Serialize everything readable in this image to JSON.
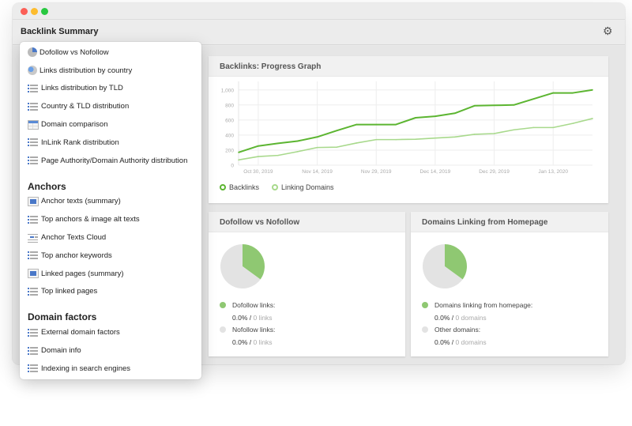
{
  "window": {
    "title": "Backlink Summary",
    "settings_icon": "gear-icon"
  },
  "menu": {
    "groups": [
      {
        "heading": "",
        "items": [
          {
            "label": "Dofollow vs Nofollow",
            "icon": "pie-chart-icon"
          },
          {
            "label": "Links distribution by country",
            "icon": "globe-icon"
          },
          {
            "label": "Links distribution by TLD",
            "icon": "list-icon"
          },
          {
            "label": "Country & TLD distribution",
            "icon": "list-icon"
          },
          {
            "label": "Domain comparison",
            "icon": "table-icon"
          },
          {
            "label": "InLink Rank distribution",
            "icon": "list-icon"
          },
          {
            "label": "Page Authority/Domain Authority distribution",
            "icon": "list-icon"
          }
        ]
      },
      {
        "heading": "Anchors",
        "items": [
          {
            "label": "Anchor texts (summary)",
            "icon": "summary-box-icon"
          },
          {
            "label": "Top anchors & image alt texts",
            "icon": "list-icon"
          },
          {
            "label": "Anchor Texts Cloud",
            "icon": "tag-cloud-icon"
          },
          {
            "label": "Top anchor keywords",
            "icon": "list-icon"
          },
          {
            "label": "Linked pages (summary)",
            "icon": "summary-box-icon"
          },
          {
            "label": "Top linked pages",
            "icon": "list-icon"
          }
        ]
      },
      {
        "heading": "Domain factors",
        "items": [
          {
            "label": "External domain factors",
            "icon": "list-icon"
          },
          {
            "label": "Domain info",
            "icon": "list-icon"
          },
          {
            "label": "Indexing in search engines",
            "icon": "list-icon"
          }
        ]
      }
    ]
  },
  "colors": {
    "backlinks": "#5cb531",
    "linking_domains": "#a8d98c",
    "pie_green": "#8fc872",
    "pie_grey": "#e3e3e3"
  },
  "progress_card": {
    "title": "Backlinks: Progress Graph"
  },
  "chart_data": [
    {
      "type": "line",
      "title": "Backlinks: Progress Graph",
      "xlabel": "",
      "ylabel": "",
      "ylim": [
        0,
        1050
      ],
      "yticks": [
        "0",
        "200",
        "400",
        "600",
        "800",
        "1,000"
      ],
      "ytick_values": [
        0,
        200,
        400,
        600,
        800,
        1000
      ],
      "xticks": [
        "Oct 30, 2019",
        "Nov 14, 2019",
        "Nov 29, 2019",
        "Dec 14, 2019",
        "Dec 29, 2019",
        "Jan 13, 2020"
      ],
      "xtick_index": [
        1.0,
        4.0,
        7.0,
        10.0,
        13.0,
        16.0
      ],
      "grid": true,
      "legend": "bottom-left",
      "x": [
        "Oct 25",
        "Oct 30",
        "Nov 4",
        "Nov 9",
        "Nov 14",
        "Nov 19",
        "Nov 24",
        "Nov 29",
        "Dec 4",
        "Dec 9",
        "Dec 14",
        "Dec 19",
        "Dec 24",
        "Dec 29",
        "Jan 3",
        "Jan 8",
        "Jan 13",
        "Jan 18",
        "Jan 23"
      ],
      "series": [
        {
          "name": "Backlinks",
          "values": [
            170,
            255,
            290,
            320,
            375,
            460,
            540,
            540,
            540,
            630,
            650,
            690,
            790,
            795,
            800,
            880,
            960,
            960,
            1000
          ]
        },
        {
          "name": "Linking Domains",
          "values": [
            70,
            115,
            130,
            180,
            235,
            240,
            295,
            340,
            340,
            345,
            360,
            375,
            410,
            420,
            470,
            500,
            500,
            555,
            620
          ]
        }
      ]
    },
    {
      "type": "pie",
      "title": "Dofollow vs Nofollow",
      "labels": [
        "Dofollow links",
        "Nofollow links"
      ],
      "values": [
        35,
        65
      ]
    },
    {
      "type": "pie",
      "title": "Domains Linking from Homepage",
      "labels": [
        "Domains linking from homepage",
        "Other domains"
      ],
      "values": [
        35,
        65
      ]
    }
  ],
  "dofollow_card": {
    "title": "Dofollow vs Nofollow",
    "stats": [
      {
        "label": "Dofollow links:",
        "percent": "0.0%",
        "count": "0 links"
      },
      {
        "label": "Nofollow links:",
        "percent": "0.0%",
        "count": "0 links"
      }
    ]
  },
  "homepage_card": {
    "title": "Domains Linking from Homepage",
    "stats": [
      {
        "label": "Domains linking from homepage:",
        "percent": "0.0%",
        "count": "0 domains"
      },
      {
        "label": "Other domains:",
        "percent": "0.0%",
        "count": "0 domains"
      }
    ]
  },
  "separator": " / "
}
